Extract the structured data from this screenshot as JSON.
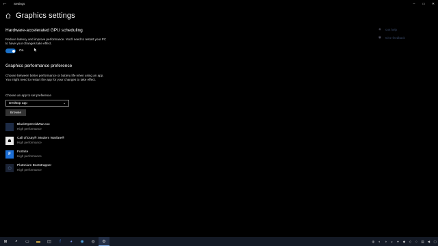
{
  "window": {
    "title": "Settings",
    "back_icon": "back-arrow-icon",
    "controls": [
      "minimize",
      "maximize",
      "close"
    ]
  },
  "header": {
    "title": "Graphics settings",
    "home_icon": "home-icon"
  },
  "side_links": {
    "help": "Get help",
    "feedback": "Give feedback"
  },
  "gpu_scheduling": {
    "title": "Hardware-accelerated GPU scheduling",
    "description": "Reduce latency and improve performance. You'll need to restart your PC to have your changes take effect.",
    "toggle_state": "On",
    "toggle_on": true
  },
  "preference": {
    "title": "Graphics performance preference",
    "description": "Choose between better performance or battery life when using an app. You might need to restart the app for your changes to take effect.",
    "select_label": "Choose an app to set preference",
    "select_value": "Desktop app",
    "browse_label": "Browse"
  },
  "apps": [
    {
      "name": "BlackOpsColdWar.exe",
      "preference": "High performance",
      "icon": "blank-app-icon"
    },
    {
      "name": "Call of Duty®: Modern Warfare®",
      "preference": "High performance",
      "icon": "cod-app-icon"
    },
    {
      "name": "Fortnite",
      "preference": "High performance",
      "icon": "fortnite-app-icon"
    },
    {
      "name": "Plutonium Bootstrapper",
      "preference": "High performance",
      "icon": "plutonium-app-icon"
    }
  ],
  "colors": {
    "accent": "#1a70c8",
    "background": "#000000",
    "taskbar": "#141a26",
    "link": "#3a4a6a"
  },
  "taskbar": {
    "icons": [
      "windows-start-icon",
      "search-icon",
      "task-view-icon",
      "file-explorer-icon",
      "store-icon",
      "facebook-icon",
      "discord-icon",
      "browser-icon",
      "steam-icon",
      "settings-icon"
    ]
  }
}
